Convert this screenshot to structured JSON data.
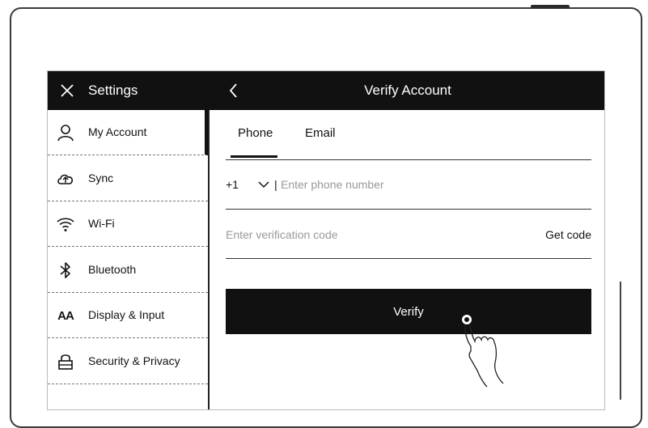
{
  "header": {
    "settings_title": "Settings",
    "page_title": "Verify Account"
  },
  "sidebar": {
    "items": [
      {
        "label": "My Account",
        "icon": "user-icon"
      },
      {
        "label": "Sync",
        "icon": "cloud-sync-icon"
      },
      {
        "label": "Wi-Fi",
        "icon": "wifi-icon"
      },
      {
        "label": "Bluetooth",
        "icon": "bluetooth-icon"
      },
      {
        "label": "Display & Input",
        "icon": "display-aa-icon"
      },
      {
        "label": "Security & Privacy",
        "icon": "lock-icon"
      }
    ]
  },
  "tabs": [
    {
      "label": "Phone",
      "active": true
    },
    {
      "label": "Email",
      "active": false
    }
  ],
  "form": {
    "country_code": "+1",
    "separator": "|",
    "phone_placeholder": "Enter phone number",
    "code_placeholder": "Enter verification code",
    "get_code_label": "Get code",
    "verify_label": "Verify"
  },
  "colors": {
    "bar_bg": "#111111",
    "bar_text": "#ffffff",
    "placeholder": "#999999"
  }
}
